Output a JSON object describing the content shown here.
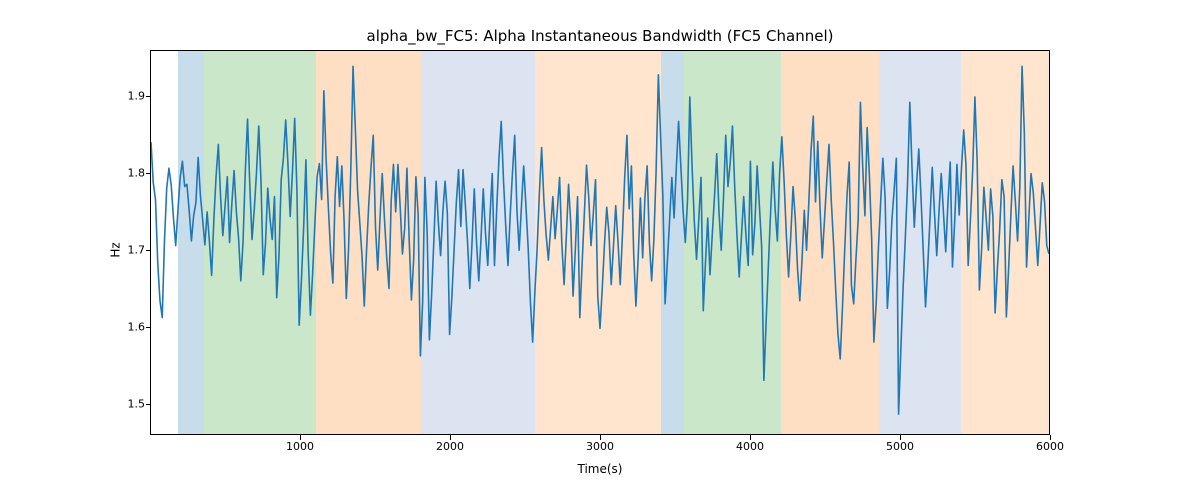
{
  "chart_data": {
    "type": "line",
    "title": "alpha_bw_FC5: Alpha Instantaneous Bandwidth (FC5 Channel)",
    "xlabel": "Time(s)",
    "ylabel": "Hz",
    "xlim": [
      0,
      6000
    ],
    "ylim": [
      1.46,
      1.96
    ],
    "xticks": [
      1000,
      2000,
      3000,
      4000,
      5000,
      6000
    ],
    "yticks": [
      1.5,
      1.6,
      1.7,
      1.8,
      1.9
    ],
    "background_spans": [
      {
        "x0": 180,
        "x1": 350,
        "color": "blue"
      },
      {
        "x0": 350,
        "x1": 1100,
        "color": "green"
      },
      {
        "x0": 1100,
        "x1": 1800,
        "color": "orange"
      },
      {
        "x0": 1800,
        "x1": 2560,
        "color": "lightblue"
      },
      {
        "x0": 2560,
        "x1": 3400,
        "color": "peach"
      },
      {
        "x0": 3400,
        "x1": 3550,
        "color": "blue"
      },
      {
        "x0": 3550,
        "x1": 4200,
        "color": "green"
      },
      {
        "x0": 4200,
        "x1": 4850,
        "color": "orange"
      },
      {
        "x0": 4850,
        "x1": 5400,
        "color": "lightblue"
      },
      {
        "x0": 5400,
        "x1": 6000,
        "color": "peach"
      }
    ],
    "x": [
      0,
      15,
      30,
      45,
      60,
      75,
      90,
      105,
      120,
      135,
      150,
      165,
      180,
      195,
      210,
      225,
      240,
      255,
      270,
      285,
      300,
      315,
      330,
      345,
      360,
      375,
      390,
      405,
      420,
      435,
      450,
      465,
      480,
      495,
      510,
      525,
      540,
      555,
      570,
      585,
      600,
      615,
      630,
      645,
      660,
      675,
      690,
      705,
      720,
      735,
      750,
      765,
      780,
      795,
      810,
      825,
      840,
      855,
      870,
      885,
      900,
      915,
      930,
      945,
      960,
      975,
      990,
      1005,
      1020,
      1035,
      1050,
      1065,
      1080,
      1095,
      1110,
      1125,
      1140,
      1155,
      1170,
      1185,
      1200,
      1215,
      1230,
      1245,
      1260,
      1275,
      1290,
      1305,
      1320,
      1335,
      1350,
      1365,
      1380,
      1395,
      1410,
      1425,
      1440,
      1455,
      1470,
      1485,
      1500,
      1515,
      1530,
      1545,
      1560,
      1575,
      1590,
      1605,
      1620,
      1635,
      1650,
      1665,
      1680,
      1695,
      1710,
      1725,
      1740,
      1755,
      1770,
      1785,
      1800,
      1815,
      1830,
      1845,
      1860,
      1875,
      1890,
      1905,
      1920,
      1935,
      1950,
      1965,
      1980,
      1995,
      2010,
      2025,
      2040,
      2055,
      2070,
      2085,
      2100,
      2115,
      2130,
      2145,
      2160,
      2175,
      2190,
      2205,
      2220,
      2235,
      2250,
      2265,
      2280,
      2295,
      2310,
      2325,
      2340,
      2355,
      2370,
      2385,
      2400,
      2415,
      2430,
      2445,
      2460,
      2475,
      2490,
      2505,
      2520,
      2535,
      2550,
      2565,
      2580,
      2595,
      2610,
      2625,
      2640,
      2655,
      2670,
      2685,
      2700,
      2715,
      2730,
      2745,
      2760,
      2775,
      2790,
      2805,
      2820,
      2835,
      2850,
      2865,
      2880,
      2895,
      2910,
      2925,
      2940,
      2955,
      2970,
      2985,
      3000,
      3015,
      3030,
      3045,
      3060,
      3075,
      3090,
      3105,
      3120,
      3135,
      3150,
      3165,
      3180,
      3195,
      3210,
      3225,
      3240,
      3255,
      3270,
      3285,
      3300,
      3315,
      3330,
      3345,
      3360,
      3375,
      3390,
      3405,
      3420,
      3435,
      3450,
      3465,
      3480,
      3495,
      3510,
      3525,
      3540,
      3555,
      3570,
      3585,
      3600,
      3615,
      3630,
      3645,
      3660,
      3675,
      3690,
      3705,
      3720,
      3735,
      3750,
      3765,
      3780,
      3795,
      3810,
      3825,
      3840,
      3855,
      3870,
      3885,
      3900,
      3915,
      3930,
      3945,
      3960,
      3975,
      3990,
      4005,
      4020,
      4035,
      4050,
      4065,
      4080,
      4095,
      4110,
      4125,
      4140,
      4155,
      4170,
      4185,
      4200,
      4215,
      4230,
      4245,
      4260,
      4275,
      4290,
      4305,
      4320,
      4335,
      4350,
      4365,
      4380,
      4395,
      4410,
      4425,
      4440,
      4455,
      4470,
      4485,
      4500,
      4515,
      4530,
      4545,
      4560,
      4575,
      4590,
      4605,
      4620,
      4635,
      4650,
      4665,
      4680,
      4695,
      4710,
      4725,
      4740,
      4755,
      4770,
      4785,
      4800,
      4815,
      4830,
      4845,
      4860,
      4875,
      4890,
      4905,
      4920,
      4935,
      4950,
      4965,
      4980,
      4995,
      5010,
      5025,
      5040,
      5055,
      5070,
      5085,
      5100,
      5115,
      5130,
      5145,
      5160,
      5175,
      5190,
      5205,
      5220,
      5235,
      5250,
      5265,
      5280,
      5295,
      5310,
      5325,
      5340,
      5355,
      5370,
      5385,
      5400,
      5415,
      5430,
      5445,
      5460,
      5475,
      5490,
      5505,
      5520,
      5535,
      5550,
      5565,
      5580,
      5595,
      5610,
      5625,
      5640,
      5655,
      5670,
      5685,
      5700,
      5715,
      5730,
      5745,
      5760,
      5775,
      5790,
      5805,
      5820,
      5835,
      5850,
      5865,
      5880,
      5895,
      5910,
      5925,
      5940,
      5955,
      5970,
      5985,
      6000
    ],
    "y": [
      1.841,
      1.788,
      1.766,
      1.683,
      1.634,
      1.612,
      1.712,
      1.781,
      1.807,
      1.785,
      1.742,
      1.706,
      1.752,
      1.795,
      1.816,
      1.783,
      1.786,
      1.752,
      1.712,
      1.745,
      1.762,
      1.821,
      1.772,
      1.74,
      1.707,
      1.75,
      1.712,
      1.667,
      1.74,
      1.797,
      1.838,
      1.769,
      1.719,
      1.758,
      1.796,
      1.71,
      1.76,
      1.804,
      1.751,
      1.716,
      1.66,
      1.711,
      1.802,
      1.871,
      1.786,
      1.714,
      1.753,
      1.802,
      1.862,
      1.79,
      1.668,
      1.709,
      1.781,
      1.741,
      1.714,
      1.77,
      1.638,
      1.693,
      1.792,
      1.821,
      1.87,
      1.812,
      1.744,
      1.802,
      1.872,
      1.778,
      1.602,
      1.661,
      1.73,
      1.818,
      1.697,
      1.615,
      1.67,
      1.735,
      1.796,
      1.813,
      1.766,
      1.908,
      1.819,
      1.756,
      1.697,
      1.657,
      1.77,
      1.822,
      1.757,
      1.81,
      1.739,
      1.637,
      1.702,
      1.805,
      1.94,
      1.86,
      1.779,
      1.736,
      1.692,
      1.627,
      1.699,
      1.76,
      1.808,
      1.85,
      1.73,
      1.674,
      1.741,
      1.8,
      1.74,
      1.69,
      1.65,
      1.765,
      1.812,
      1.75,
      1.812,
      1.756,
      1.695,
      1.729,
      1.807,
      1.714,
      1.635,
      1.688,
      1.796,
      1.746,
      1.562,
      1.632,
      1.795,
      1.724,
      1.583,
      1.642,
      1.713,
      1.79,
      1.736,
      1.693,
      1.75,
      1.79,
      1.748,
      1.59,
      1.638,
      1.7,
      1.762,
      1.805,
      1.731,
      1.805,
      1.76,
      1.71,
      1.65,
      1.71,
      1.78,
      1.71,
      1.66,
      1.715,
      1.78,
      1.722,
      1.68,
      1.745,
      1.8,
      1.68,
      1.755,
      1.82,
      1.868,
      1.792,
      1.732,
      1.68,
      1.746,
      1.8,
      1.85,
      1.752,
      1.7,
      1.757,
      1.81,
      1.758,
      1.703,
      1.633,
      1.58,
      1.646,
      1.702,
      1.775,
      1.834,
      1.765,
      1.72,
      1.687,
      1.728,
      1.77,
      1.715,
      1.753,
      1.795,
      1.708,
      1.655,
      1.718,
      1.786,
      1.733,
      1.64,
      1.7,
      1.77,
      1.612,
      1.68,
      1.746,
      1.811,
      1.768,
      1.706,
      1.747,
      1.792,
      1.64,
      1.598,
      1.65,
      1.708,
      1.756,
      1.722,
      1.655,
      1.705,
      1.758,
      1.712,
      1.655,
      1.72,
      1.795,
      1.85,
      1.754,
      1.81,
      1.696,
      1.627,
      1.69,
      1.768,
      1.69,
      1.768,
      1.81,
      1.71,
      1.66,
      1.714,
      1.804,
      1.929,
      1.848,
      1.77,
      1.63,
      1.685,
      1.739,
      1.795,
      1.742,
      1.808,
      1.868,
      1.81,
      1.752,
      1.71,
      1.766,
      1.9,
      1.81,
      1.738,
      1.688,
      1.74,
      1.795,
      1.621,
      1.685,
      1.742,
      1.668,
      1.72,
      1.77,
      1.826,
      1.75,
      1.7,
      1.768,
      1.85,
      1.783,
      1.814,
      1.862,
      1.783,
      1.72,
      1.665,
      1.718,
      1.77,
      1.72,
      1.68,
      1.816,
      1.694,
      1.735,
      1.81,
      1.758,
      1.705,
      1.53,
      1.607,
      1.68,
      1.75,
      1.815,
      1.754,
      1.712,
      1.8,
      1.848,
      1.79,
      1.72,
      1.665,
      1.72,
      1.783,
      1.74,
      1.675,
      1.634,
      1.688,
      1.752,
      1.7,
      1.762,
      1.83,
      1.875,
      1.763,
      1.842,
      1.755,
      1.69,
      1.74,
      1.79,
      1.838,
      1.766,
      1.71,
      1.647,
      1.59,
      1.558,
      1.625,
      1.7,
      1.77,
      1.815,
      1.654,
      1.63,
      1.688,
      1.74,
      1.893,
      1.81,
      1.745,
      1.86,
      1.797,
      1.715,
      1.58,
      1.63,
      1.702,
      1.762,
      1.82,
      1.768,
      1.624,
      1.672,
      1.738,
      1.778,
      1.82,
      1.486,
      1.57,
      1.65,
      1.716,
      1.788,
      1.893,
      1.806,
      1.73,
      1.786,
      1.832,
      1.768,
      1.698,
      1.626,
      1.68,
      1.742,
      1.808,
      1.748,
      1.693,
      1.75,
      1.8,
      1.748,
      1.698,
      1.763,
      1.815,
      1.678,
      1.738,
      1.812,
      1.746,
      1.806,
      1.857,
      1.812,
      1.68,
      1.74,
      1.804,
      1.9,
      1.816,
      1.648,
      1.702,
      1.782,
      1.742,
      1.7,
      1.78,
      1.744,
      1.618,
      1.675,
      1.725,
      1.792,
      1.77,
      1.613,
      1.675,
      1.745,
      1.81,
      1.764,
      1.712,
      1.782,
      1.94,
      1.854,
      1.678,
      1.74,
      1.8,
      1.775,
      1.728,
      1.68,
      1.732,
      1.788,
      1.764,
      1.706,
      1.695
    ]
  }
}
